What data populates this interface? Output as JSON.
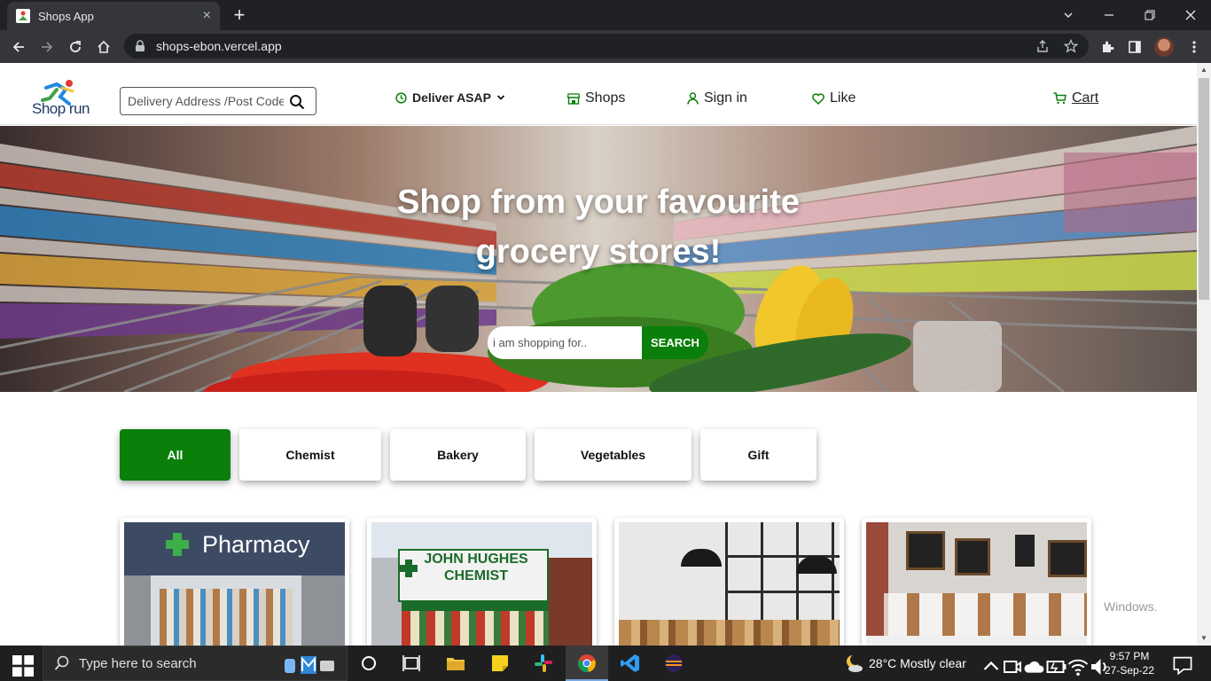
{
  "browser": {
    "tab_title": "Shops App",
    "tab_close": "×",
    "new_tab": "+",
    "url": "shops-ebon.vercel.app"
  },
  "header": {
    "logo_text": "Shop run",
    "address_placeholder": "Delivery Address /Post Code",
    "deliver_label": "Deliver ASAP",
    "shops_label": "Shops",
    "signin_label": "Sign in",
    "like_label": "Like",
    "cart_label": "Cart"
  },
  "hero": {
    "title": "Shop from your favourite grocery stores!",
    "search_placeholder": "i am shopping for..",
    "search_button": "SEARCH"
  },
  "categories": [
    {
      "label": "All",
      "active": true
    },
    {
      "label": "Chemist",
      "active": false
    },
    {
      "label": "Bakery",
      "active": false
    },
    {
      "label": "Vegetables",
      "active": false
    },
    {
      "label": "Gift",
      "active": false
    }
  ],
  "cards": [
    {
      "sign": "Pharmacy"
    },
    {
      "sign": "JOHN HUGHES CHEMIST"
    },
    {
      "sign": ""
    },
    {
      "sign": ""
    }
  ],
  "watermark": "Windows.",
  "taskbar": {
    "search_placeholder": "Type here to search",
    "weather": "28°C  Mostly clear",
    "time": "9:57 PM",
    "date": "27-Sep-22"
  },
  "colors": {
    "accent_green": "#0a7f0a",
    "chrome_dark": "#202124",
    "chrome_bar": "#35363a"
  }
}
